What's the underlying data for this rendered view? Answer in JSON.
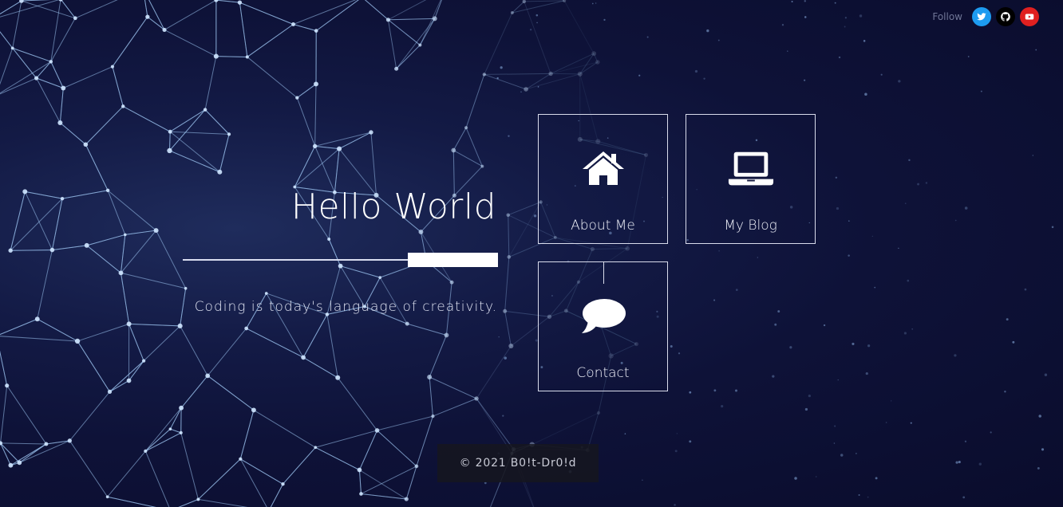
{
  "follow": {
    "label": "Follow",
    "links": [
      {
        "name": "twitter",
        "icon": "twitter-icon",
        "color": "#1d9bf0"
      },
      {
        "name": "github",
        "icon": "github-icon",
        "color": "#000000"
      },
      {
        "name": "youtube",
        "icon": "youtube-icon",
        "color": "#e02020"
      }
    ]
  },
  "hero": {
    "title": "Hello World",
    "tagline": "Coding is today's language of creativity."
  },
  "tiles": [
    {
      "id": "about",
      "label": "About Me",
      "icon": "home-icon"
    },
    {
      "id": "blog",
      "label": "My Blog",
      "icon": "laptop-icon"
    },
    {
      "id": "contact",
      "label": "Contact",
      "icon": "speech-bubble-icon"
    }
  ],
  "footer": {
    "text": "© 2021 B0!t-Dr0!d"
  },
  "colors": {
    "background": "#0e1238",
    "network": "#9fc6f2",
    "tile_border": "#d9dcec"
  }
}
